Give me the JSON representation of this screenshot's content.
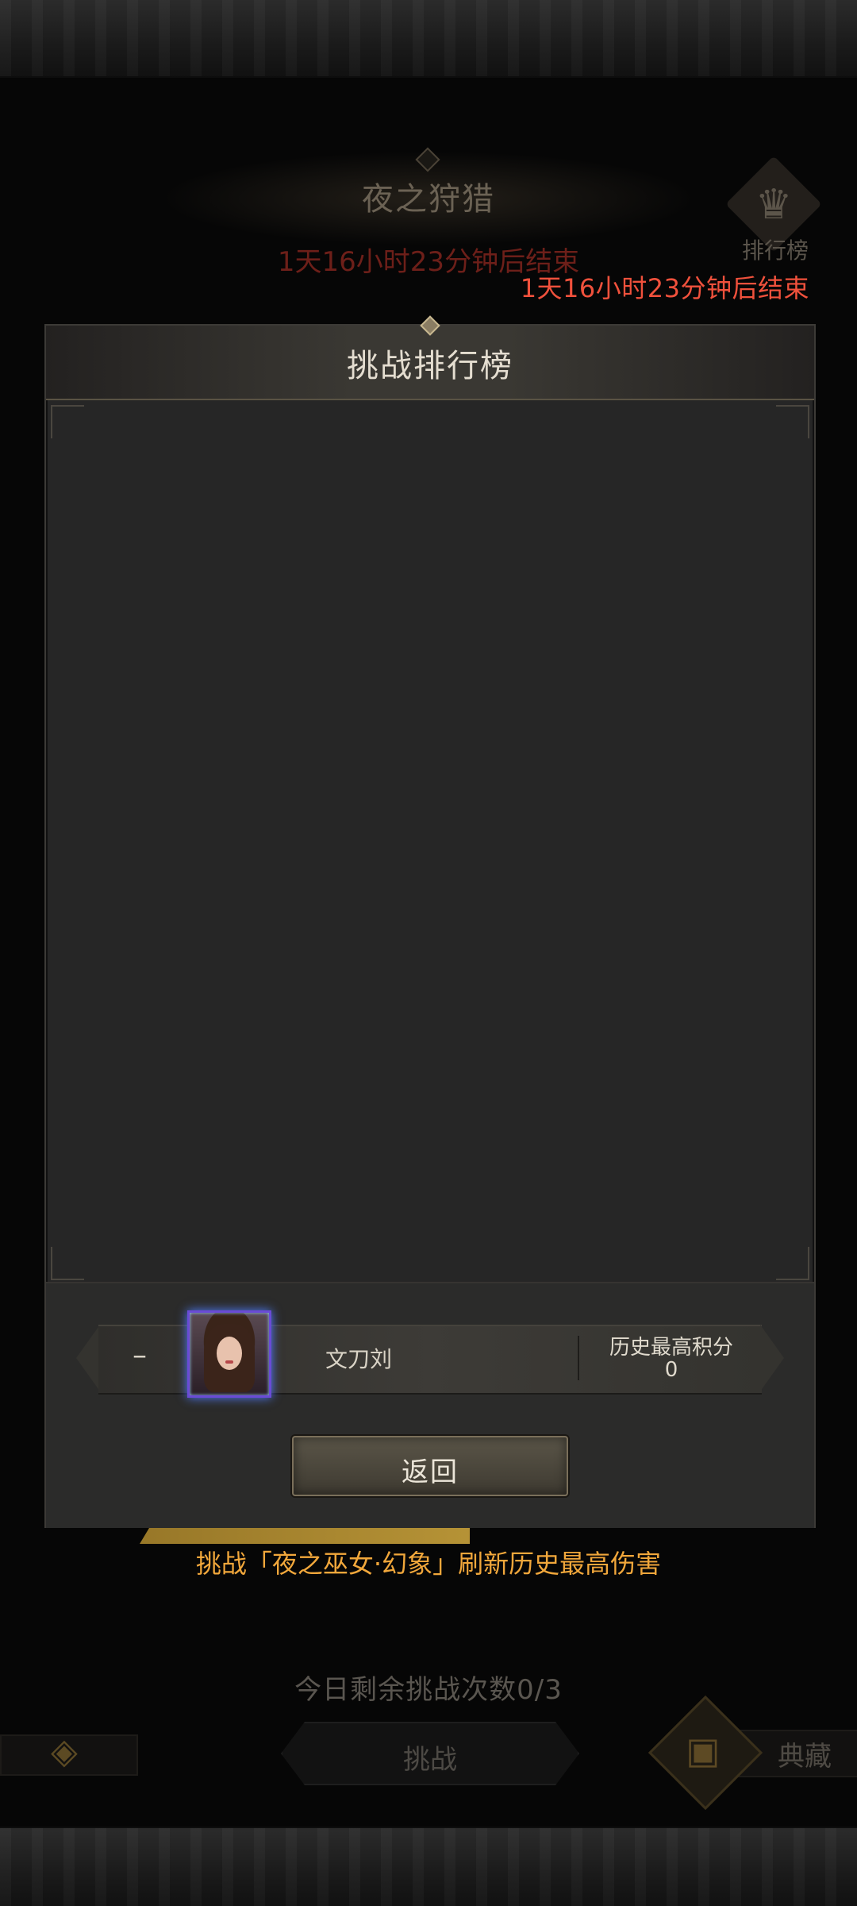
{
  "background": {
    "title": "夜之狩猎",
    "timer": "1天16小时23分钟后结束",
    "rank_button_label": "排行榜",
    "hint": "挑战「夜之巫女·幻象」刷新历史最高伤害",
    "remaining_label": "今日剩余挑战次数0/3",
    "challenge_label": "挑战",
    "collection_label": "典藏"
  },
  "overlay_timer": "1天16小时23分钟后结束",
  "modal": {
    "title": "挑战排行榜",
    "entries": [],
    "my_entry": {
      "rank": "–",
      "name": "文刀刘",
      "score_label": "历史最高积分",
      "score": "0"
    },
    "back_label": "返回"
  },
  "icons": {
    "crown": "crown-icon",
    "chest": "chest-icon",
    "arrow": "back-arrow-icon"
  },
  "colors": {
    "timer_red": "#f0513c",
    "hint_orange": "#f1a73b",
    "avatar_border": "#6a4bd6"
  }
}
